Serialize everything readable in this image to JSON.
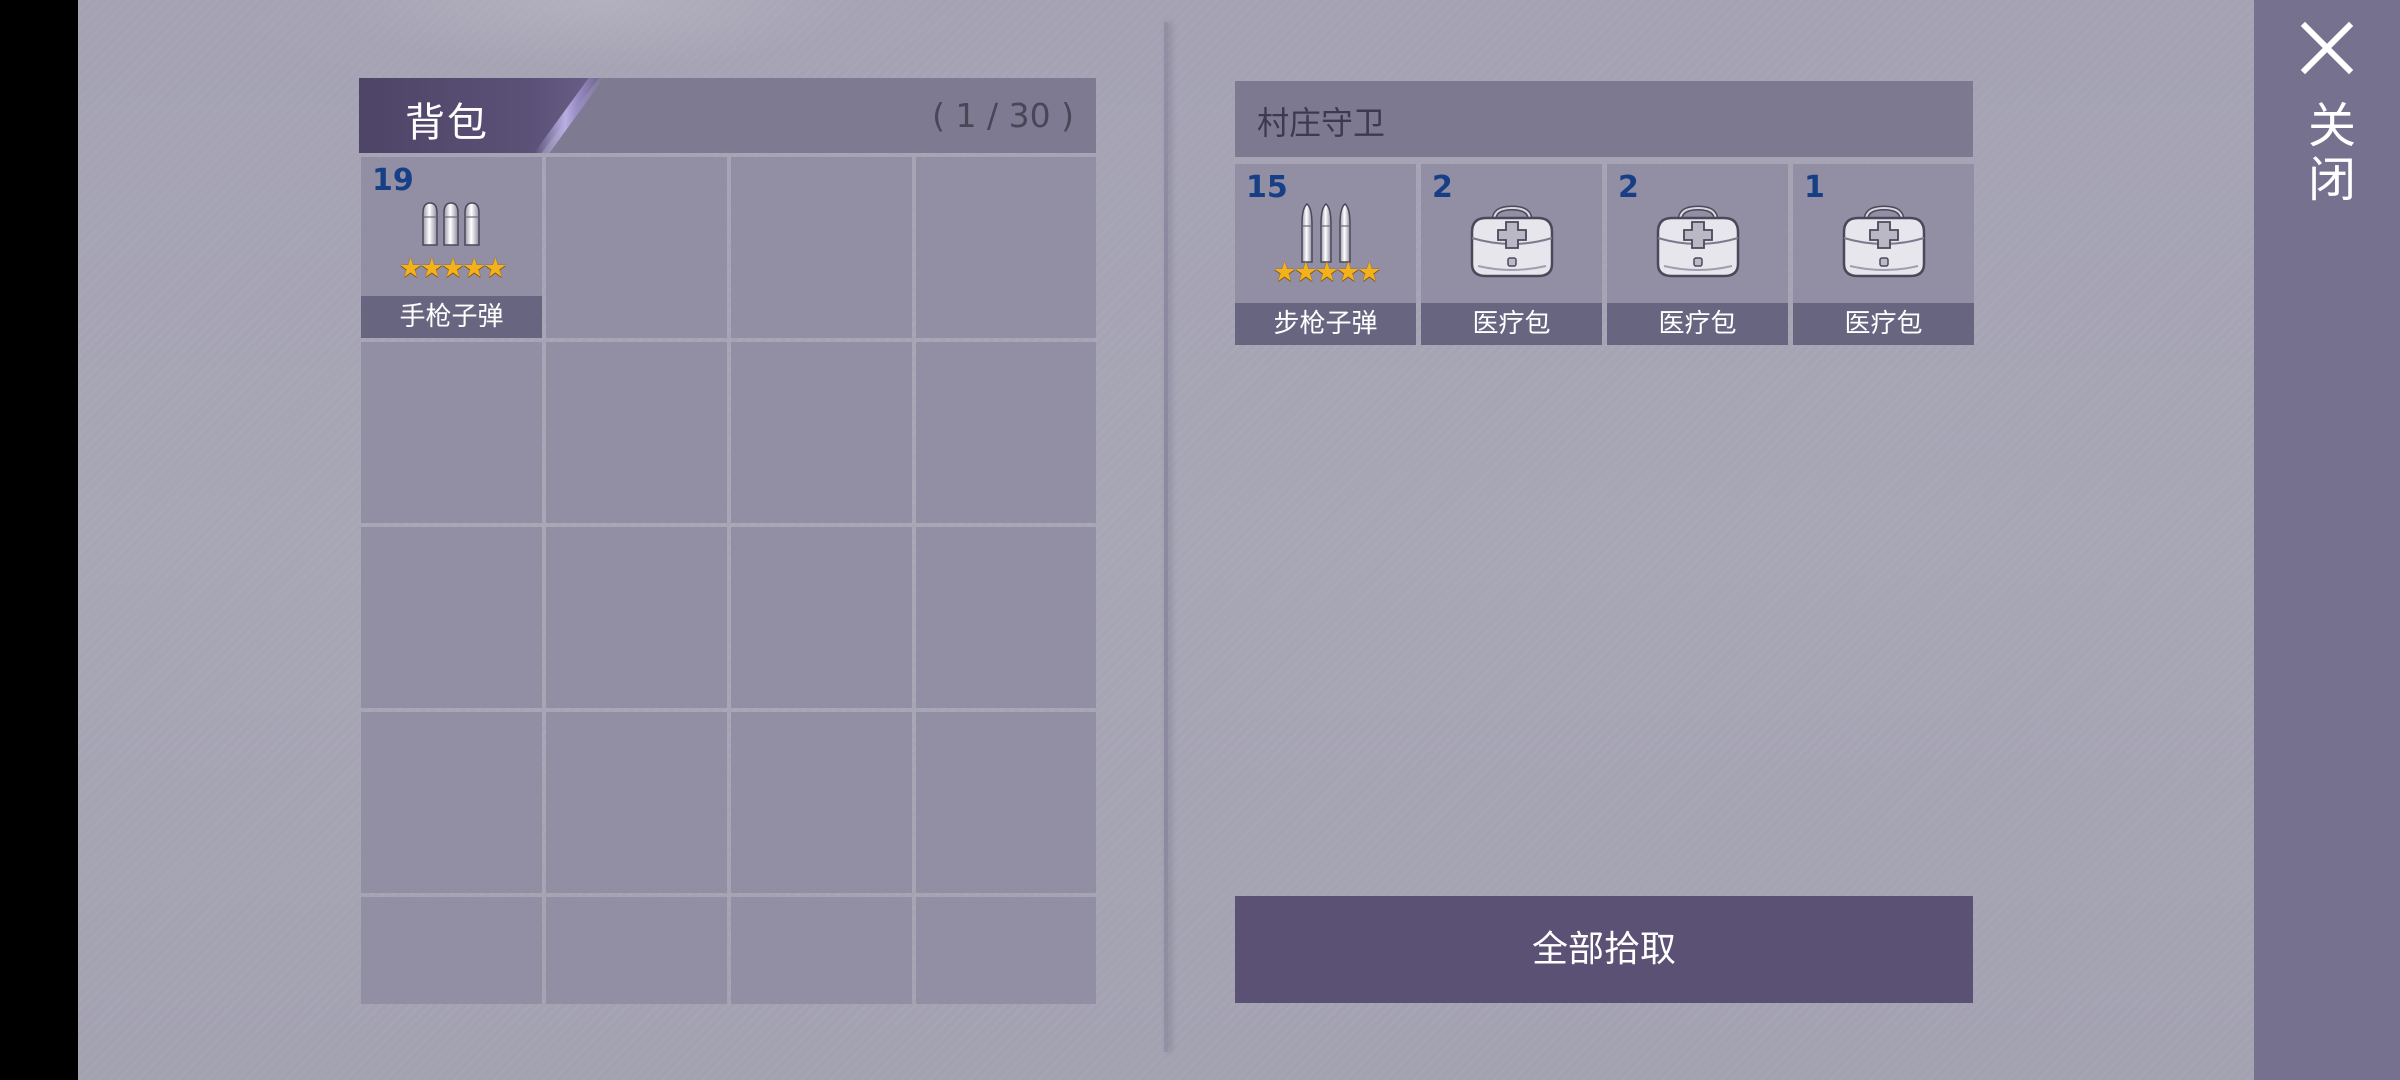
{
  "backpack": {
    "title": "背包",
    "count": "( 1 / 30 )",
    "empty_slots_visible": 19,
    "items": [
      {
        "quantity": "19",
        "name": "手枪子弹",
        "icon": "pistol-ammo-icon",
        "stars": "★★★★★",
        "rating": 5
      }
    ]
  },
  "loot": {
    "title": "村庄守卫",
    "items": [
      {
        "quantity": "15",
        "name": "步枪子弹",
        "icon": "rifle-ammo-icon",
        "stars": "★★★★★",
        "rating": 5
      },
      {
        "quantity": "2",
        "name": "医疗包",
        "icon": "medkit-icon"
      },
      {
        "quantity": "2",
        "name": "医疗包",
        "icon": "medkit-icon"
      },
      {
        "quantity": "1",
        "name": "医疗包",
        "icon": "medkit-icon"
      }
    ],
    "pickup_all_label": "全部拾取"
  },
  "close": {
    "label": "关闭",
    "icon": "close-icon"
  },
  "colors": {
    "panel_header": "#7e7a91",
    "slot": "#928ea4",
    "item_label_bg": "#686580",
    "quantity_text": "#173f86",
    "button": "#5b5174",
    "close_bar": "#76718f",
    "star": "#f4b21a"
  }
}
